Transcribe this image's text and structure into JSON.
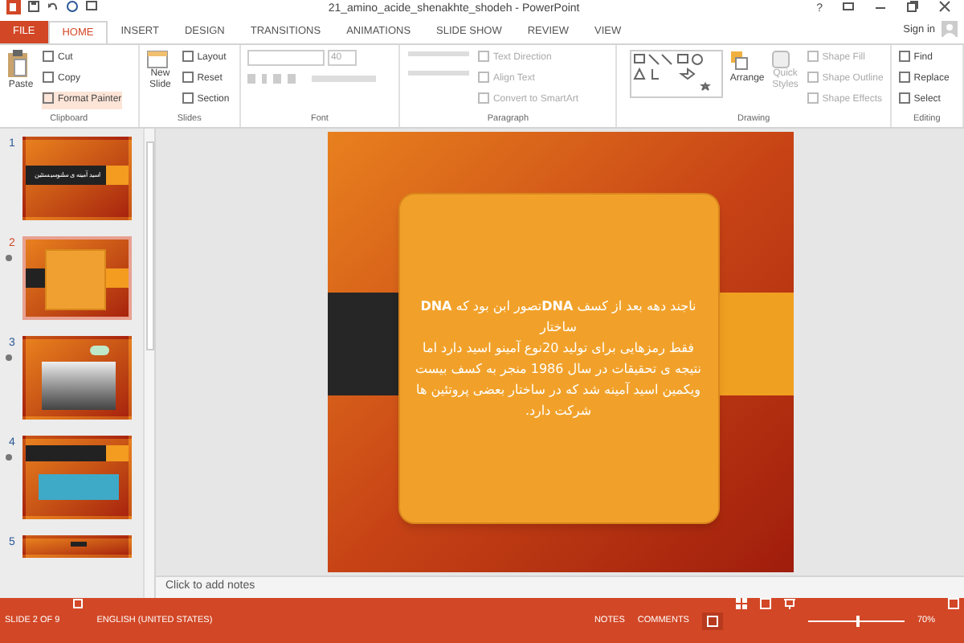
{
  "window": {
    "title": "21_amino_acide_shenakhte_shodeh - PowerPoint",
    "help": "?"
  },
  "tabs": [
    {
      "label": "FILE",
      "kind": "file",
      "selected": false
    },
    {
      "label": "HOME",
      "kind": "tab",
      "selected": true
    },
    {
      "label": "INSERT",
      "kind": "tab",
      "selected": false
    },
    {
      "label": "DESIGN",
      "kind": "tab",
      "selected": false
    },
    {
      "label": "TRANSITIONS",
      "kind": "tab",
      "selected": false
    },
    {
      "label": "ANIMATIONS",
      "kind": "tab",
      "selected": false
    },
    {
      "label": "SLIDE SHOW",
      "kind": "tab",
      "selected": false
    },
    {
      "label": "REVIEW",
      "kind": "tab",
      "selected": false
    },
    {
      "label": "VIEW",
      "kind": "tab",
      "selected": false
    }
  ],
  "sign_in": "Sign in",
  "ribbon": {
    "clipboard": {
      "label": "Clipboard",
      "paste": "Paste",
      "cut": "Cut",
      "copy": "Copy",
      "format_painter": "Format Painter"
    },
    "slides": {
      "label": "Slides",
      "new_slide": "New Slide",
      "layout": "Layout",
      "reset": "Reset",
      "section": "Section"
    },
    "font": {
      "label": "Font",
      "size": "40"
    },
    "paragraph": {
      "label": "Paragraph",
      "text_direction": "Text Direction",
      "align_text": "Align Text",
      "convert": "Convert to SmartArt"
    },
    "drawing": {
      "label": "Drawing",
      "arrange": "Arrange",
      "quick_styles": "Quick Styles",
      "shape_fill": "Shape Fill",
      "shape_outline": "Shape Outline",
      "shape_effects": "Shape Effects"
    },
    "editing": {
      "label": "Editing",
      "find": "Find",
      "replace": "Replace",
      "select": "Select"
    }
  },
  "thumbnails": [
    {
      "number": "1",
      "kind": "title",
      "selected": false,
      "animated": false,
      "title": "اسید آمینه ی سلنوسیستئین"
    },
    {
      "number": "2",
      "kind": "scroll",
      "selected": true,
      "animated": true
    },
    {
      "number": "3",
      "kind": "gray",
      "selected": false,
      "animated": true
    },
    {
      "number": "4",
      "kind": "blue",
      "selected": false,
      "animated": true
    },
    {
      "number": "5",
      "kind": "partial",
      "selected": false,
      "animated": false
    }
  ],
  "slide": {
    "lines": [
      "ناجند دهه بعد از کسف **DNA**تصور ابن بود که **DNA**",
      "ساختار",
      "فقط رمزهایی برای تولید 20نوع آمینو اسید دارد اما",
      "نتیجه ی تحقیقات در سال 1986 منجر به کسف بیست",
      "ویکمین اسید آمینه شد که در ساختار بعضی پروتئین ها",
      "شرکت دارد."
    ]
  },
  "notes": {
    "placeholder": "Click to add notes"
  },
  "status_bar": {
    "slide": "SLIDE 2 OF 9",
    "language": "ENGLISH (UNITED STATES)",
    "notes": "NOTES",
    "comments": "COMMENTS",
    "zoom": "70%",
    "zoom_slider": {
      "level": 0.5
    }
  }
}
